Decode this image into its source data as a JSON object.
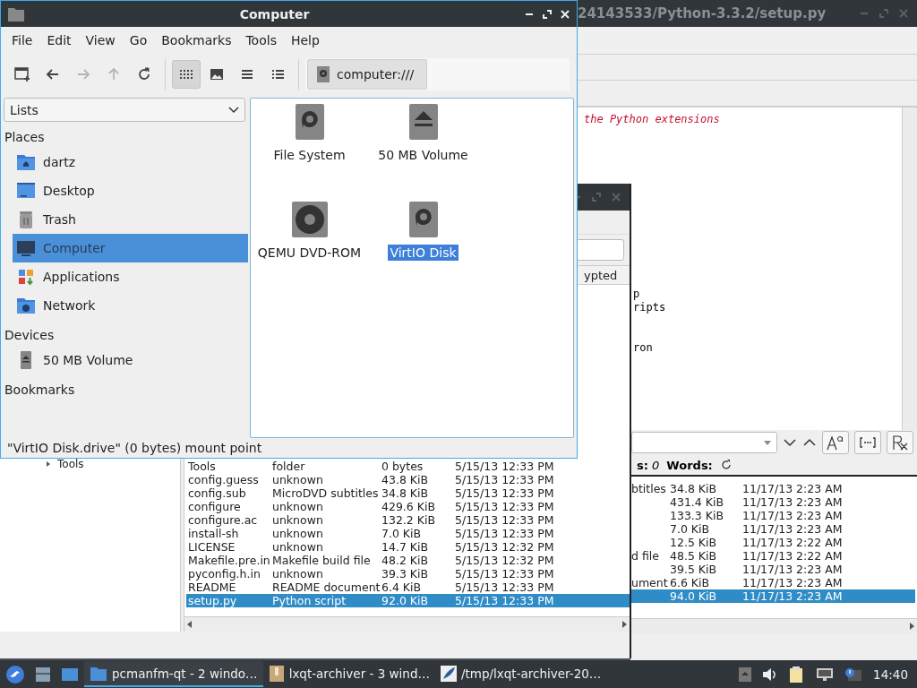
{
  "file_manager": {
    "title": "Computer",
    "menu": [
      "File",
      "Edit",
      "View",
      "Go",
      "Bookmarks",
      "Tools",
      "Help"
    ],
    "toolbar_buttons": [
      {
        "disabled": false
      },
      {
        "disabled": false
      },
      {
        "disabled": true
      },
      {
        "disabled": true
      },
      {
        "disabled": false
      }
    ],
    "view_buttons": [
      {
        "selected": true
      },
      {
        "selected": false
      },
      {
        "selected": false
      },
      {
        "selected": false
      }
    ],
    "location": "computer:///",
    "side_pane_mode": "Lists",
    "sidebar": [
      {
        "title": "Places",
        "items": [
          {
            "label": "dartz",
            "kind": "home",
            "selected": false
          },
          {
            "label": "Desktop",
            "kind": "desktop",
            "selected": false
          },
          {
            "label": "Trash",
            "kind": "trash",
            "selected": false
          },
          {
            "label": "Computer",
            "kind": "computer",
            "selected": true
          },
          {
            "label": "Applications",
            "kind": "apps",
            "selected": false
          },
          {
            "label": "Network",
            "kind": "network",
            "selected": false
          }
        ]
      },
      {
        "title": "Devices",
        "items": [
          {
            "label": "50 MB Volume",
            "kind": "removable",
            "selected": false
          }
        ]
      },
      {
        "title": "Bookmarks"
      }
    ],
    "items": [
      {
        "label": "File System",
        "kind": "drive",
        "selected": false
      },
      {
        "label": "50 MB Volume",
        "kind": "removable",
        "selected": false
      },
      {
        "label": "QEMU DVD-ROM",
        "kind": "disc",
        "selected": false
      },
      {
        "label": "VirtIO Disk",
        "kind": "drive",
        "selected": true
      }
    ],
    "status": "\"VirtIO Disk.drive\" (0 bytes) mount point"
  },
  "editor": {
    "title": "24143533/Python-3.3.2/setup.py",
    "comment_line": "the Python extensions",
    "code_lines": [
      "p",
      "ripts",
      "ron"
    ],
    "count": "**s:** *0*",
    "words_label": "Words:"
  },
  "archiver": {
    "column_fragment": "ypted",
    "tree_item": "Tools",
    "rows": [
      {
        "name": "Tools",
        "type": "folder",
        "size": "0 bytes",
        "modified": "5/15/13 12:33 PM",
        "selected": false
      },
      {
        "name": "config.guess",
        "type": "unknown",
        "size": "43.8 KiB",
        "modified": "5/15/13 12:33 PM",
        "selected": false
      },
      {
        "name": "config.sub",
        "type": "MicroDVD subtitles",
        "size": "34.8 KiB",
        "modified": "5/15/13 12:33 PM",
        "selected": false
      },
      {
        "name": "configure",
        "type": "unknown",
        "size": "429.6 KiB",
        "modified": "5/15/13 12:33 PM",
        "selected": false
      },
      {
        "name": "configure.ac",
        "type": "unknown",
        "size": "132.2 KiB",
        "modified": "5/15/13 12:33 PM",
        "selected": false
      },
      {
        "name": "install-sh",
        "type": "unknown",
        "size": "7.0 KiB",
        "modified": "5/15/13 12:33 PM",
        "selected": false
      },
      {
        "name": "LICENSE",
        "type": "unknown",
        "size": "14.7 KiB",
        "modified": "5/15/13 12:32 PM",
        "selected": false
      },
      {
        "name": "Makefile.pre.in",
        "type": "Makefile build file",
        "size": "48.2 KiB",
        "modified": "5/15/13 12:32 PM",
        "selected": false
      },
      {
        "name": "pyconfig.h.in",
        "type": "unknown",
        "size": "39.3 KiB",
        "modified": "5/15/13 12:33 PM",
        "selected": false
      },
      {
        "name": "README",
        "type": "README document",
        "size": "6.4 KiB",
        "modified": "5/15/13 12:33 PM",
        "selected": false
      },
      {
        "name": "setup.py",
        "type": "Python script",
        "size": "92.0 KiB",
        "modified": "5/15/13 12:33 PM",
        "selected": true
      }
    ]
  },
  "second_list": {
    "rows": [
      {
        "type": "btitles",
        "size": "34.8 KiB",
        "modified": "11/17/13 2:23 AM",
        "selected": false
      },
      {
        "size": "431.4 KiB",
        "modified": "11/17/13 2:23 AM",
        "selected": false
      },
      {
        "size": "133.3 KiB",
        "modified": "11/17/13 2:23 AM",
        "selected": false
      },
      {
        "size": "7.0 KiB",
        "modified": "11/17/13 2:23 AM",
        "selected": false
      },
      {
        "size": "12.5 KiB",
        "modified": "11/17/13 2:22 AM",
        "selected": false
      },
      {
        "type": "d file",
        "size": "48.5 KiB",
        "modified": "11/17/13 2:22 AM",
        "selected": false
      },
      {
        "size": "39.5 KiB",
        "modified": "11/17/13 2:23 AM",
        "selected": false
      },
      {
        "type": "ument",
        "size": "6.6 KiB",
        "modified": "11/17/13 2:23 AM",
        "selected": false
      },
      {
        "size": "94.0 KiB",
        "modified": "11/17/13 2:23 AM",
        "selected": true
      }
    ]
  },
  "taskbar": {
    "tasks": [
      {
        "label": "pcmanfm-qt - 2 windo…",
        "kind": "folder",
        "selected": true
      },
      {
        "label": "lxqt-archiver - 3 wind…",
        "kind": "archive",
        "selected": false
      },
      {
        "label": "/tmp/lxqt-archiver-20…",
        "kind": "editor",
        "selected": false
      }
    ],
    "clock": "14:40"
  }
}
